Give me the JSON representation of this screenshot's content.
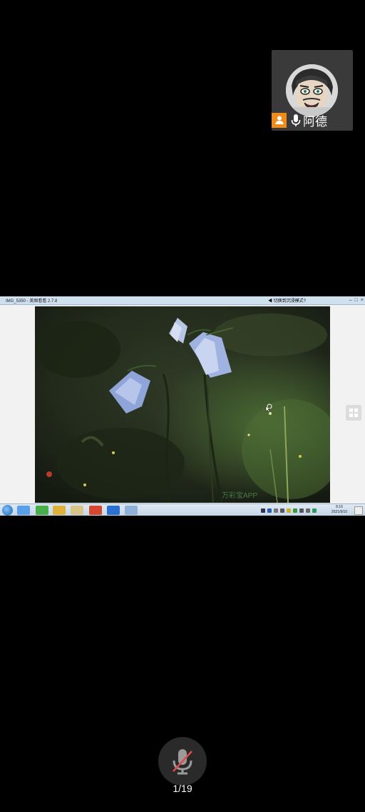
{
  "speaker": {
    "name": "阿德",
    "host_badge_icon": "person-icon",
    "mic_icon": "microphone-icon",
    "badge_color": "#f08a1a"
  },
  "shared_screen": {
    "window_title": "IMG_5350 - 美图看看 2.7.8",
    "title_right_text": "◀ 切换到沉浸模式?",
    "watermark": "万彩宝APP",
    "taskbar_clock": "8:16",
    "taskbar_date": "2021/9/10"
  },
  "bottom": {
    "mic_icon": "microphone-muted-icon",
    "page_indicator": "1/19"
  }
}
